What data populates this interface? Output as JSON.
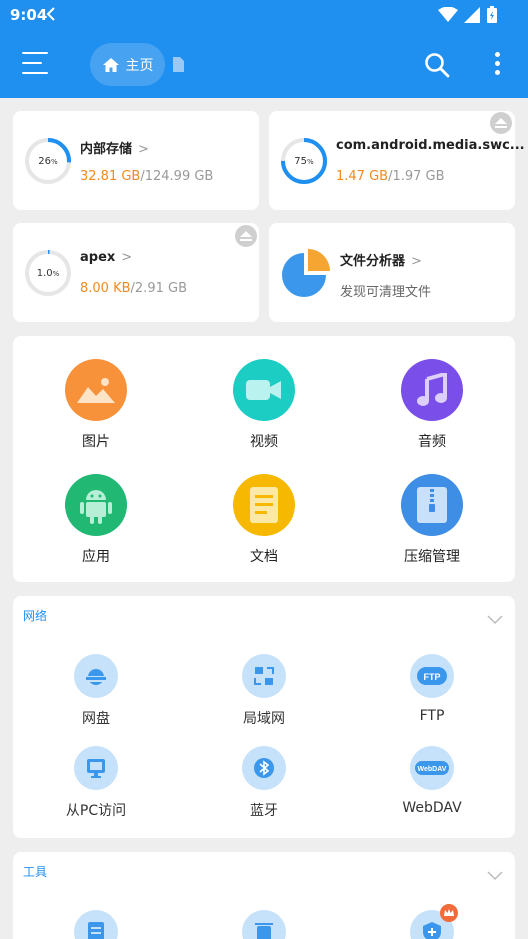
{
  "status_bar": {
    "time": "9:04"
  },
  "header": {
    "home_label": "主页"
  },
  "storage": [
    {
      "name": "内部存储",
      "percent_text": "26",
      "percent_unit": "%",
      "percent": 26,
      "used": "32.81 GB",
      "total": "/124.99 GB"
    },
    {
      "name": "com.android.media.swc...",
      "percent_text": "75",
      "percent_unit": "%",
      "percent": 75,
      "used": "1.47 GB",
      "total": "/1.97 GB"
    },
    {
      "name": "apex",
      "percent_text": "1.0",
      "percent_unit": "%",
      "percent": 1,
      "used": "8.00 KB",
      "total": "/2.91 GB"
    },
    {
      "name": "文件分析器",
      "subtitle": "发现可清理文件"
    }
  ],
  "categories": [
    {
      "label": "图片",
      "icon": "image-icon",
      "color": "#f7913a"
    },
    {
      "label": "视频",
      "icon": "video-icon",
      "color": "#1ccdc3"
    },
    {
      "label": "音频",
      "icon": "music-icon",
      "color": "#7a4ee8"
    },
    {
      "label": "应用",
      "icon": "android-icon",
      "color": "#20b873"
    },
    {
      "label": "文档",
      "icon": "document-icon",
      "color": "#f6b800"
    },
    {
      "label": "压缩管理",
      "icon": "zip-icon",
      "color": "#3e8ee6"
    }
  ],
  "network": {
    "title": "网络",
    "items": [
      {
        "label": "网盘",
        "icon": "cloud-icon"
      },
      {
        "label": "局域网",
        "icon": "lan-icon"
      },
      {
        "label": "FTP",
        "icon": "ftp-icon",
        "badge": "FTP"
      },
      {
        "label": "从PC访问",
        "icon": "pc-icon"
      },
      {
        "label": "蓝牙",
        "icon": "bluetooth-icon"
      },
      {
        "label": "WebDAV",
        "icon": "webdav-icon",
        "badge": "WebDAV"
      }
    ]
  },
  "tools": {
    "title": "工具"
  },
  "colors": {
    "primary": "#1f8ff0",
    "used": "#f08a1c"
  }
}
